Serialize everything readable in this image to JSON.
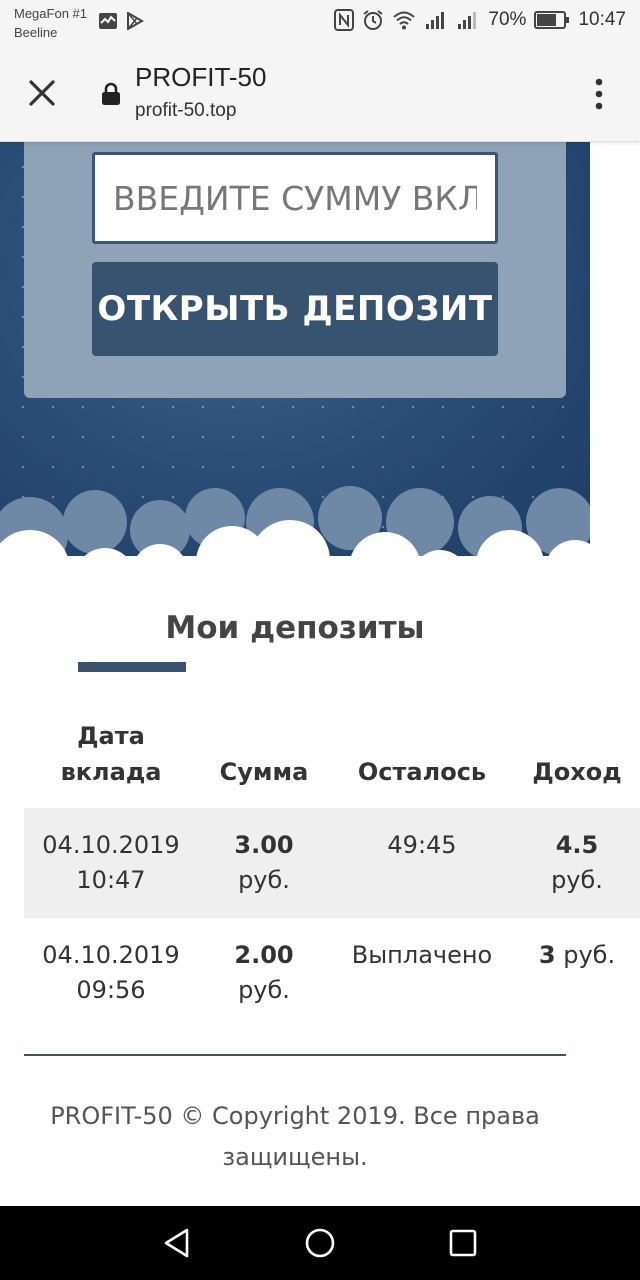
{
  "status_bar": {
    "carrier_1": "MegaFon #1",
    "carrier_2": "Beeline",
    "battery": "70%",
    "time": "10:47"
  },
  "browser": {
    "title": "PROFIT-50",
    "url": "profit-50.top"
  },
  "deposit_form": {
    "placeholder": "ВВЕДИТЕ СУММУ ВКЛАДА",
    "button_label": "ОТКРЫТЬ ДЕПОЗИТ"
  },
  "deposits": {
    "title": "Мои депозиты",
    "columns": {
      "date_line1": "Дата",
      "date_line2": "вклада",
      "amount": "Сумма",
      "remaining": "Осталось",
      "income": "Доход"
    },
    "rows": [
      {
        "date": "04.10.2019",
        "time": "10:47",
        "amount": "3.00",
        "amount_unit": "руб.",
        "remaining": "49:45",
        "income": "4.5",
        "income_unit": "руб."
      },
      {
        "date": "04.10.2019",
        "time": "09:56",
        "amount": "2.00",
        "amount_unit": "руб.",
        "remaining": "Выплачено",
        "income": "3",
        "income_unit": "руб."
      }
    ]
  },
  "footer": {
    "text": "PROFIT-50 © Copyright 2019. Все права защищены."
  },
  "colors": {
    "accent": "#38536f",
    "hero_dark": "#1c3b63",
    "panel": "#8ea2b8"
  }
}
